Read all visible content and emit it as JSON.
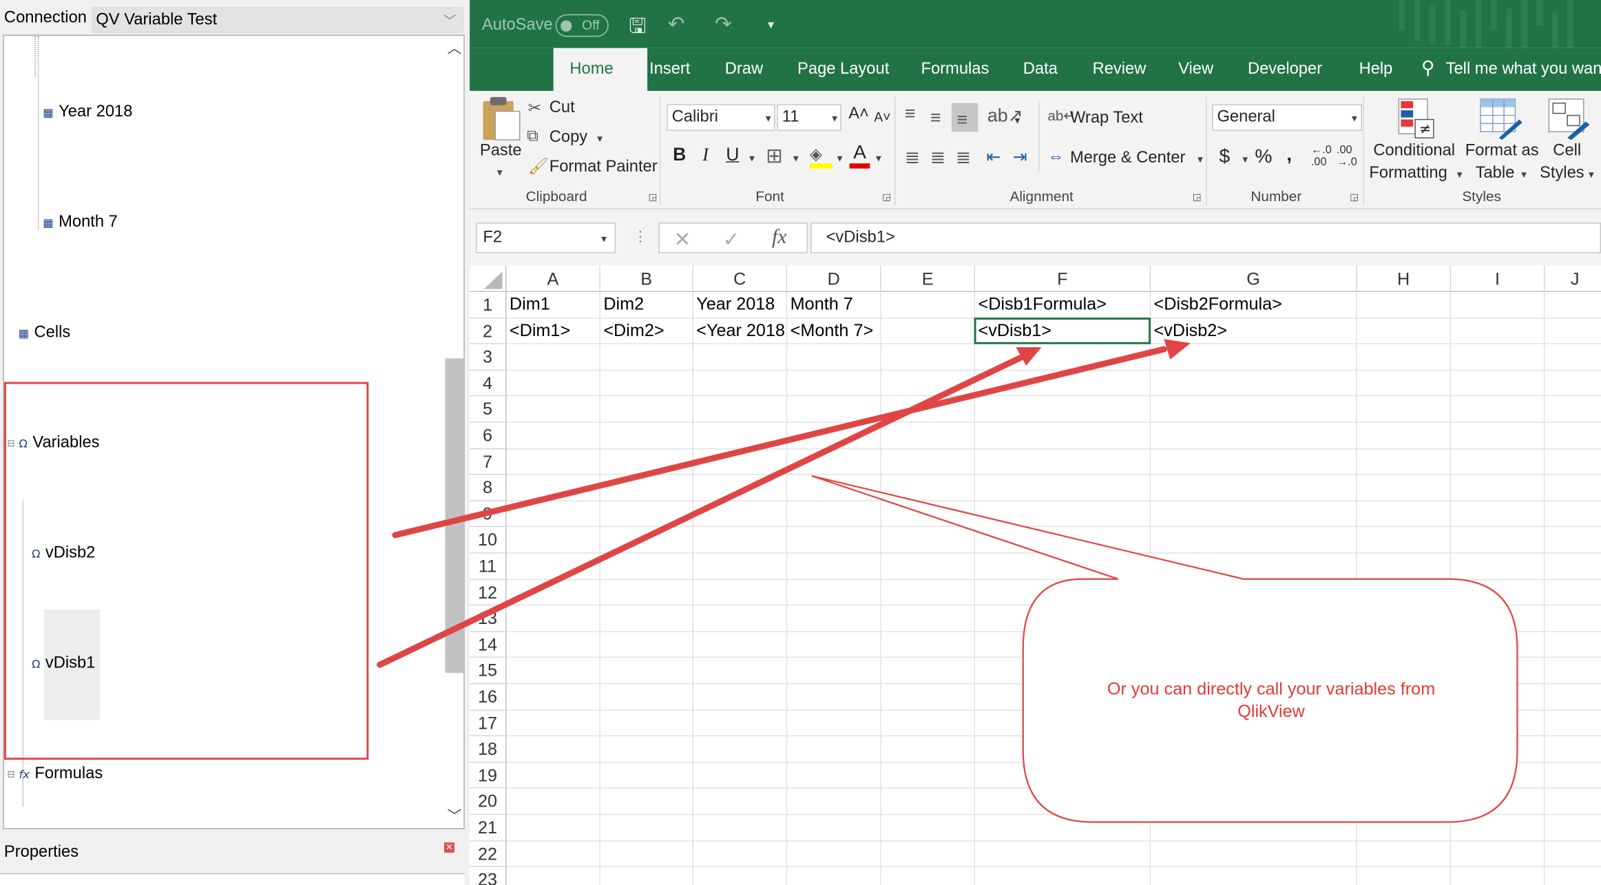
{
  "left_panel": {
    "connection_label": "Connection",
    "connection_value": "QV Variable Test",
    "tree": [
      {
        "label": "Year 2018"
      },
      {
        "label": "Month 7"
      },
      {
        "label": "Cells"
      },
      {
        "label": "Variables"
      },
      {
        "label": "vDisb2"
      },
      {
        "label": "vDisb1"
      },
      {
        "label": "Formulas"
      }
    ],
    "properties_label": "Properties"
  },
  "excel": {
    "autosave": "AutoSave",
    "toggle": "Off",
    "tabs": [
      "Home",
      "Insert",
      "Draw",
      "Page Layout",
      "Formulas",
      "Data",
      "Review",
      "View",
      "Developer",
      "Help"
    ],
    "tell_me": "Tell me what you want to do",
    "clipboard": {
      "paste": "Paste",
      "cut": "Cut",
      "copy": "Copy",
      "format_painter": "Format Painter",
      "group": "Clipboard"
    },
    "font": {
      "name": "Calibri",
      "size": "11",
      "group": "Font"
    },
    "alignment": {
      "wrap": "Wrap Text",
      "merge": "Merge & Center",
      "group": "Alignment"
    },
    "number": {
      "format": "General",
      "group": "Number"
    },
    "styles": {
      "cond1": "Conditional",
      "cond2": "Formatting",
      "fmt1": "Format as",
      "fmt2": "Table",
      "cell1": "Cell",
      "cell2": "Styles",
      "group": "Styles"
    },
    "name_box": "F2",
    "formula": "<vDisb1>",
    "columns": [
      "A",
      "B",
      "C",
      "D",
      "E",
      "F",
      "G",
      "H",
      "I",
      "J"
    ],
    "rows": [
      "1",
      "2",
      "3",
      "4",
      "5",
      "6",
      "7",
      "8",
      "9",
      "10",
      "11",
      "12",
      "13",
      "14",
      "15",
      "16",
      "17",
      "18",
      "19",
      "20",
      "21",
      "22",
      "23"
    ],
    "cells": {
      "A1": "Dim1",
      "B1": "Dim2",
      "C1": "Year 2018",
      "D1": "Month 7",
      "F1": "<Disb1Formula>",
      "G1": "<Disb2Formula>",
      "A2": "<Dim1>",
      "B2": "<Dim2>",
      "C2": "<Year 2018",
      "D2": "<Month 7>",
      "F2": "<vDisb1>",
      "G2": "<vDisb2>"
    }
  },
  "callout": "Or you can directly call your variables from QlikView",
  "colors": {
    "excel_green": "#217346",
    "annotation_red": "#e53935"
  }
}
